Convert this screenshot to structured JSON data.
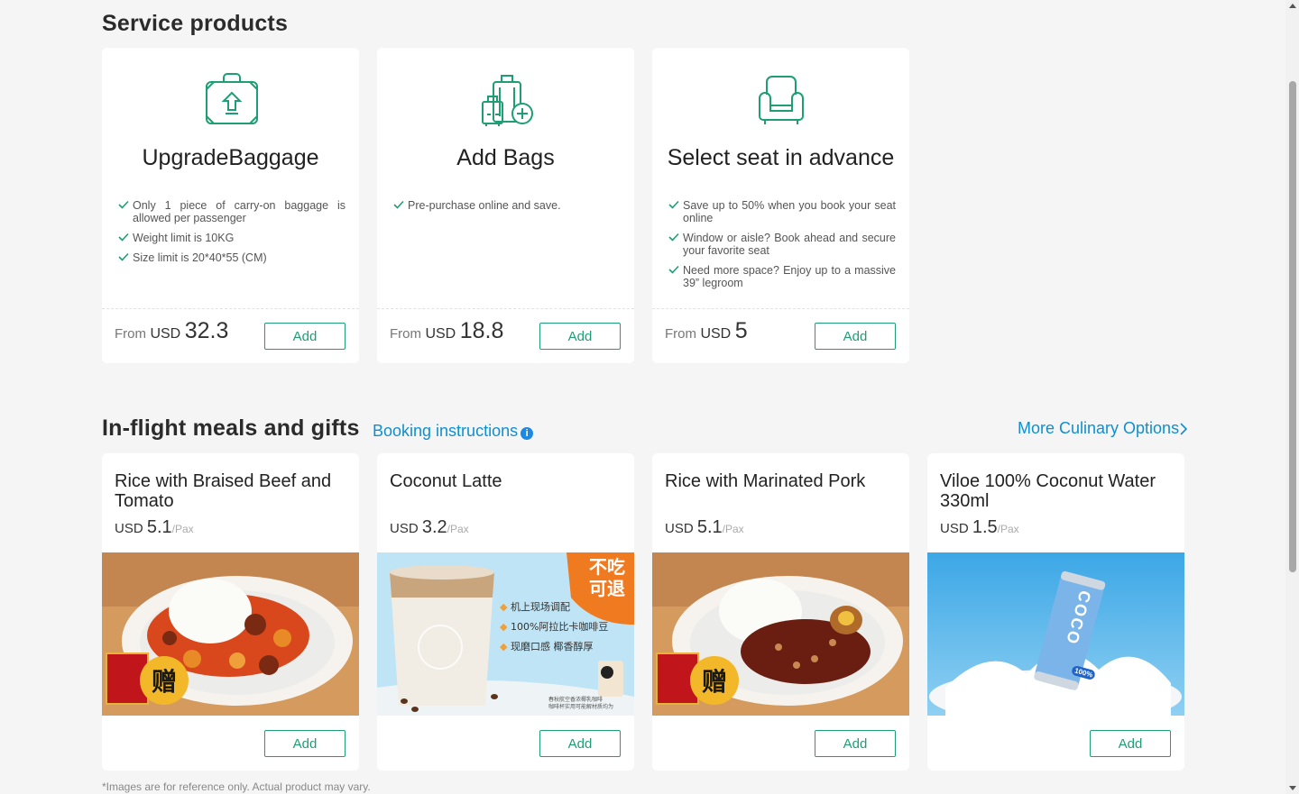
{
  "service_section": {
    "title": "Service products",
    "cards": [
      {
        "icon": "luggage-upgrade-icon",
        "title": "UpgradeBaggage",
        "features": [
          "Only 1 piece of carry-on baggage is allowed per passenger",
          "Weight limit is 10KG",
          "Size limit is 20*40*55 (CM)"
        ],
        "from_label": "From",
        "currency": "USD",
        "price": "32.3",
        "button": "Add"
      },
      {
        "icon": "add-bags-icon",
        "title": "Add Bags",
        "features": [
          "Pre-purchase online and save."
        ],
        "from_label": "From",
        "currency": "USD",
        "price": "18.8",
        "button": "Add"
      },
      {
        "icon": "seat-icon",
        "title": "Select seat in advance",
        "features": [
          "Save up to 50% when you book your seat online",
          "Window or aisle? Book ahead and secure your favorite seat",
          "Need more space? Enjoy up to a massive 39”  legroom"
        ],
        "from_label": "From",
        "currency": "USD",
        "price": "5",
        "button": "Add"
      }
    ]
  },
  "meals_section": {
    "title": "In-flight meals and gifts",
    "booking_link": "Booking instructions",
    "info_icon": "info-icon",
    "more_link": "More Culinary Options",
    "items": [
      {
        "name": "Rice with Braised Beef and Tomato",
        "currency": "USD",
        "price": "5.1",
        "unit": "/Pax",
        "button": "Add",
        "gift_badge": "赠"
      },
      {
        "name": "Coconut Latte",
        "currency": "USD",
        "price": "3.2",
        "unit": "/Pax",
        "button": "Add",
        "promo": {
          "tag_line1": "不吃",
          "tag_line2": "可退",
          "bullets": [
            "机上现场调配",
            "100%阿拉比卡咖啡豆",
            "现磨口感 椰香醇厚"
          ],
          "fine_print_1": "春秋航空香浓椰乳咖啡",
          "fine_print_2": "咖啡杯实用可能解材质均为"
        }
      },
      {
        "name": "Rice with Marinated Pork",
        "currency": "USD",
        "price": "5.1",
        "unit": "/Pax",
        "button": "Add",
        "gift_badge": "赠"
      },
      {
        "name": "Viloe 100% Coconut Water 330ml",
        "currency": "USD",
        "price": "1.5",
        "unit": "/Pax",
        "button": "Add",
        "can_text": "COCO",
        "can_badge": "100%"
      }
    ]
  },
  "footnote": "*Images are for reference only. Actual product may vary.",
  "colors": {
    "accent_green": "#1f9e74",
    "link_blue": "#0f8fcf",
    "background": "#f5f5f5"
  }
}
